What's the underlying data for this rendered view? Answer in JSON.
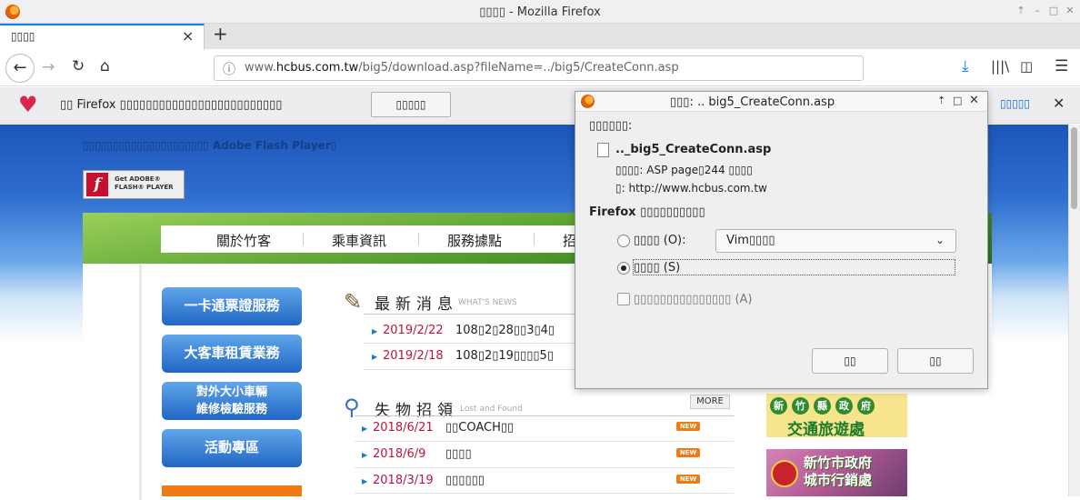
{
  "window": {
    "title": "▯▯▯▯ - Mozilla Firefox"
  },
  "tab": {
    "title": "▯▯▯▯"
  },
  "nav": {
    "url_prefix": "www.",
    "url_domain": "hcbus.com.tw",
    "url_path": "/big5/download.asp?fileName=../big5/CreateConn.asp"
  },
  "notification": {
    "text": "▯▯ Firefox ▯▯▯▯▯▯▯▯▯▯▯▯▯▯▯▯▯▯▯▯▯▯▯▯▯",
    "button": "▯▯▯▯▯",
    "link": "▯▯▯▯▯"
  },
  "site": {
    "flash_message": "▯▯▯▯▯▯▯▯▯▯▯▯▯▯▯▯▯▯▯▯▯ Adobe Flash Player▯",
    "flash_badge_line1": "Get ADOBE®",
    "flash_badge_line2": "FLASH® PLAYER",
    "menu": [
      "關於竹客",
      "乘車資訊",
      "服務據點",
      "招"
    ],
    "side_buttons": [
      "一卡通票證服務",
      "大客車租賃業務",
      "對外大小車輛",
      "維修檢驗服務",
      "活動專區"
    ],
    "news": {
      "title": "最新消息",
      "subtitle": "WHAT'S NEWS",
      "items": [
        {
          "date": "2019/2/22",
          "text": "108▯2▯28▯▯3▯4▯"
        },
        {
          "date": "2019/2/18",
          "text": "108▯2▯19▯▯▯▯5▯"
        }
      ]
    },
    "lost": {
      "title": "失物招領",
      "subtitle": "Lost and Found",
      "more": "MORE",
      "new_tag": "NEW",
      "items": [
        {
          "date": "2018/6/21",
          "text": "▯▯COACH▯▯"
        },
        {
          "date": "2018/6/9",
          "text": "▯▯▯▯"
        },
        {
          "date": "2018/3/19",
          "text": "▯▯▯▯▯▯"
        }
      ]
    },
    "ad1": {
      "chars": [
        "新",
        "竹",
        "縣",
        "政",
        "府"
      ],
      "subtitle": "交通旅遊處"
    },
    "ad2": {
      "line1": "新竹市政府",
      "line2": "城市行銷處"
    }
  },
  "dialog": {
    "title": "▯▯▯: .. big5_CreateConn.asp",
    "opening_label": "▯▯▯▯▯▯:",
    "file_name": ".._big5_CreateConn.asp",
    "file_type": "▯▯▯▯: ASP page▯244 ▯▯▯▯",
    "file_from": "▯: http://www.hcbus.com.tw",
    "question": "Firefox ▯▯▯▯▯▯▯▯▯▯",
    "open_with_label": "▯▯▯▯ (O):",
    "open_with_value": "Vim▯▯▯▯",
    "save_label": "▯▯▯▯ (S)",
    "remember_label": "▯▯▯▯▯▯▯▯▯▯▯▯▯▯▯ (A)",
    "cancel_button": "▯▯",
    "ok_button": "▯▯"
  }
}
